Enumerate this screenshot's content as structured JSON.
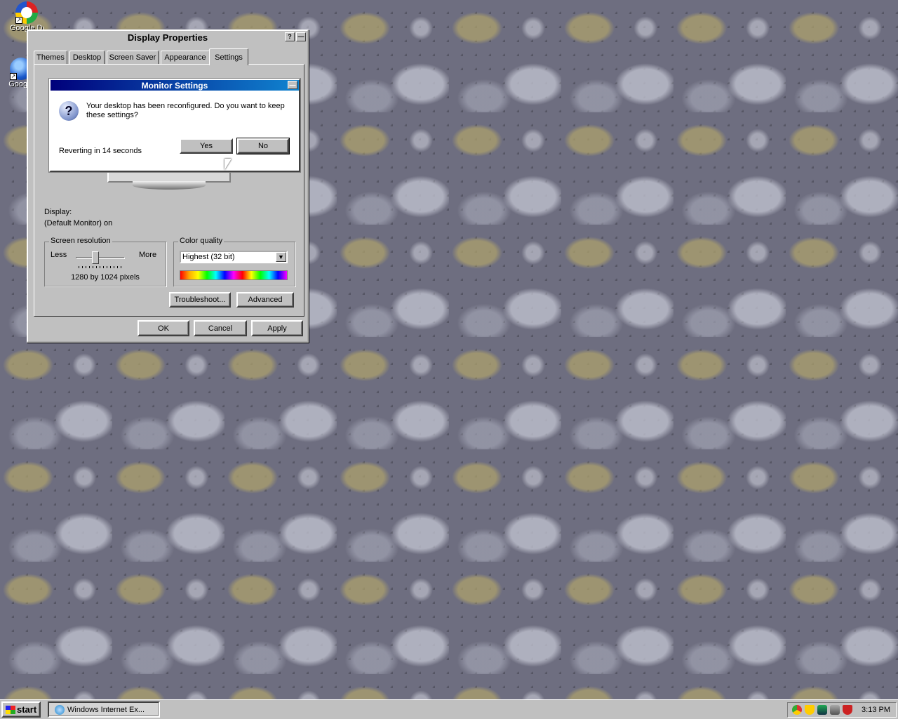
{
  "desktop": {
    "icons": [
      {
        "label": "Google Desktop",
        "icon": "google-desktop-icon"
      },
      {
        "label": "Google",
        "icon": "google-earth-icon"
      }
    ]
  },
  "display_properties": {
    "title": "Display Properties",
    "help_btn": "?",
    "min_btn": "—",
    "tabs": [
      "Themes",
      "Desktop",
      "Screen Saver",
      "Appearance",
      "Settings"
    ],
    "active_tab": "Settings",
    "display_label": "Display:",
    "display_value": "(Default Monitor) on",
    "screen_resolution": {
      "label": "Screen resolution",
      "less": "Less",
      "more": "More",
      "value_text": "1280 by 1024 pixels",
      "slider_fraction": 0.4
    },
    "color_quality": {
      "label": "Color quality",
      "selected": "Highest (32 bit)"
    },
    "troubleshoot_btn": "Troubleshoot...",
    "advanced_btn": "Advanced",
    "ok_btn": "OK",
    "cancel_btn": "Cancel",
    "apply_btn": "Apply"
  },
  "monitor_settings": {
    "title": "Monitor Settings",
    "message": "Your desktop has been reconfigured.  Do you want to keep these settings?",
    "countdown": "Reverting in 14 seconds",
    "yes_btn": "Yes",
    "no_btn": "No",
    "min_btn": "—"
  },
  "taskbar": {
    "start_label": "start",
    "task_label": "Windows Internet Ex...",
    "clock": "3:13 PM"
  },
  "colors": {
    "title_active": "#00007b",
    "face": "#c0c0c0",
    "desktop_bg": "#6e6e80"
  }
}
